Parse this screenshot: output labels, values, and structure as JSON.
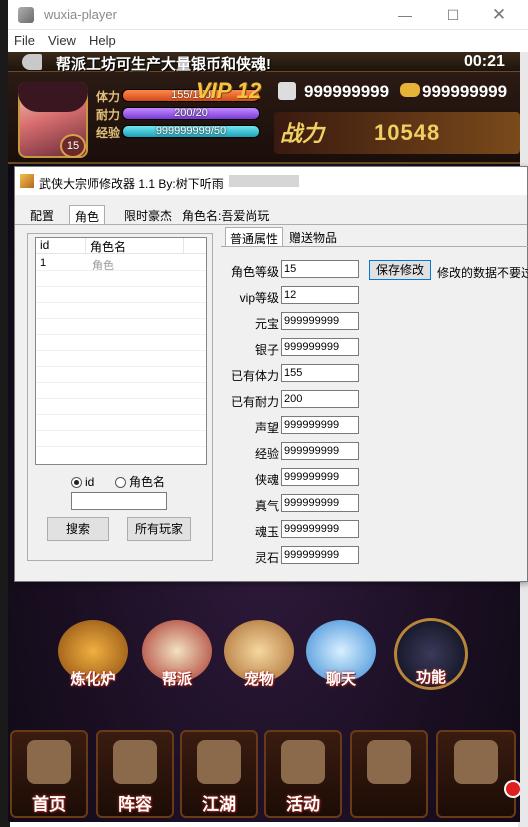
{
  "window": {
    "title": "wuxia-player",
    "menus": [
      "File",
      "View",
      "Help"
    ]
  },
  "game": {
    "marquee": "帮派工坊可生产大量银币和侠魂!",
    "clock": "00:21",
    "player": {
      "level": "15",
      "hp_label": "体力",
      "hp_text": "155/150",
      "hp_fill": 1.0,
      "en_label": "耐力",
      "en_text": "200/20",
      "en_fill": 1.0,
      "xp_label": "经验",
      "xp_text": "999999999/50",
      "xp_fill": 1.0
    },
    "vip": "VIP 12",
    "silver": "999999999",
    "gold": "999999999",
    "power_label": "战力",
    "power": "10548",
    "round_buttons": [
      {
        "label": "炼化炉",
        "icon": "furnace-icon"
      },
      {
        "label": "帮派",
        "icon": "banner-icon"
      },
      {
        "label": "宠物",
        "icon": "cat-icon"
      },
      {
        "label": "聊天",
        "icon": "chat-bubble-icon"
      },
      {
        "label": "功能",
        "icon": "gate-icon"
      }
    ],
    "dock": [
      {
        "label": "首页",
        "icon": "home-icon"
      },
      {
        "label": "阵容",
        "icon": "formation-icon"
      },
      {
        "label": "江湖",
        "icon": "swords-icon"
      },
      {
        "label": "活动",
        "icon": "gift-icon"
      },
      {
        "label": "",
        "icon": "scroll-icon"
      },
      {
        "label": "",
        "icon": "chest-icon"
      }
    ]
  },
  "editor": {
    "title": "武侠大宗师修改器 1.1 By:树下听雨",
    "tabs": [
      "配置",
      "角色",
      "限时豪杰",
      "角色名:吾爱尚玩"
    ],
    "list_headers": [
      "id",
      "角色名"
    ],
    "list_rows": [
      {
        "id": "1",
        "name": "角色"
      }
    ],
    "radio_id": "id",
    "radio_name": "角色名",
    "search_value": "",
    "btn_search": "搜索",
    "btn_all": "所有玩家",
    "right_tabs": [
      "普通属性",
      "赠送物品"
    ],
    "fields": [
      {
        "label": "角色等级",
        "value": "15"
      },
      {
        "label": "vip等级",
        "value": "12"
      },
      {
        "label": "元宝",
        "value": "999999999"
      },
      {
        "label": "银子",
        "value": "999999999"
      },
      {
        "label": "已有体力",
        "value": "155"
      },
      {
        "label": "已有耐力",
        "value": "200"
      },
      {
        "label": "声望",
        "value": "999999999"
      },
      {
        "label": "经验",
        "value": "999999999"
      },
      {
        "label": "侠魂",
        "value": "999999999"
      },
      {
        "label": "真气",
        "value": "999999999"
      },
      {
        "label": "魂玉",
        "value": "999999999"
      },
      {
        "label": "灵石",
        "value": "999999999"
      }
    ],
    "save_button": "保存修改",
    "save_hint": "修改的数据不要过"
  }
}
